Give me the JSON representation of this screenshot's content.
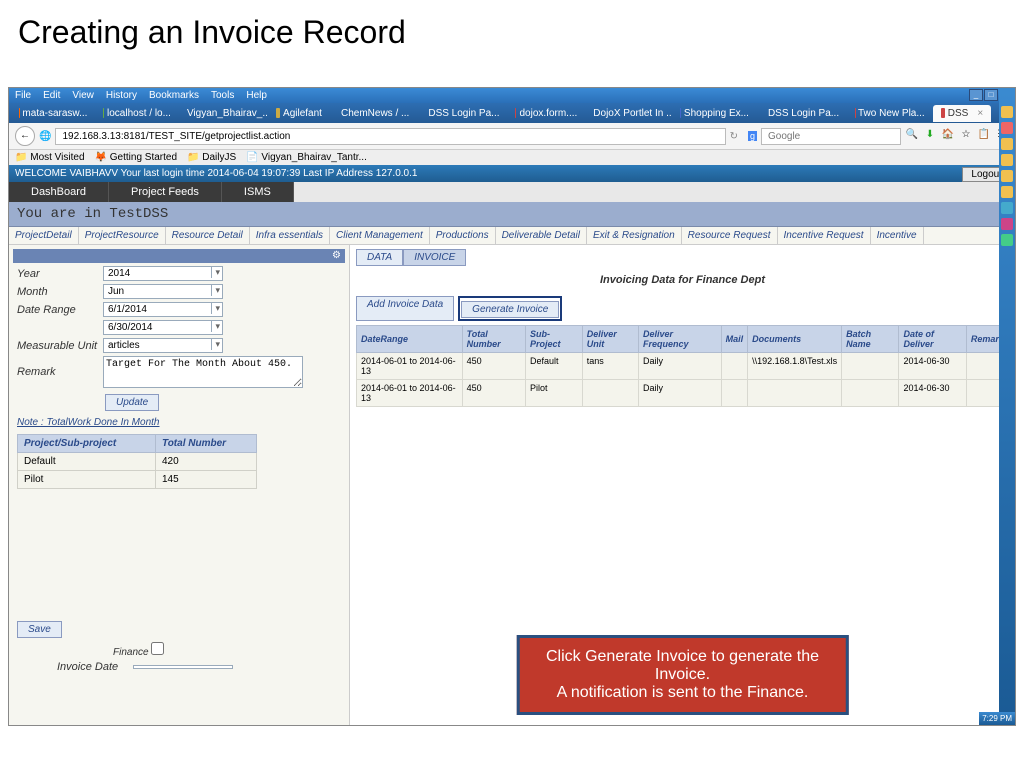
{
  "slide_title": "Creating an Invoice Record",
  "menu": [
    "File",
    "Edit",
    "View",
    "History",
    "Bookmarks",
    "Tools",
    "Help"
  ],
  "tabs": [
    "mata-sarasw...",
    "localhost / lo...",
    "Vigyan_Bhairav_...",
    "Agilefant",
    "ChemNews / ...",
    "DSS Login Pa...",
    "dojox.form....",
    "DojoX Portlet In ...",
    "Shopping Ex...",
    "DSS Login Pa...",
    "Two New Pla..."
  ],
  "active_tab": "DSS",
  "url": "192.168.3.13:8181/TEST_SITE/getprojectlist.action",
  "search_ph": "Google",
  "bookmarks": [
    "Most Visited",
    "Getting Started",
    "DailyJS",
    "Vigyan_Bhairav_Tantr..."
  ],
  "welcome": "WELCOME  VAIBHAVV  Your last login time 2014-06-04 19:07:39 Last IP Address 127.0.0.1",
  "logout": "Logout",
  "app_tabs": [
    "DashBoard",
    "Project Feeds",
    "ISMS"
  ],
  "you_are_in": "You are in TestDSS",
  "sub_tabs": [
    "ProjectDetail",
    "ProjectResource",
    "Resource Detail",
    "Infra essentials",
    "Client Management",
    "Productions",
    "Deliverable Detail",
    "Exit & Resignation",
    "Resource Request",
    "Incentive Request",
    "Incentive"
  ],
  "form": {
    "year_lbl": "Year",
    "year": "2014",
    "month_lbl": "Month",
    "month": "Jun",
    "range_lbl": "Date Range",
    "date1": "6/1/2014",
    "date2": "6/30/2014",
    "unit_lbl": "Measurable Unit",
    "unit": "articles",
    "remark_lbl": "Remark",
    "remark": "Target For The Month About 450.",
    "update": "Update"
  },
  "note": "Note : TotalWork Done In Month",
  "mini": {
    "h1": "Project/Sub-project",
    "h2": "Total Number",
    "rows": [
      {
        "p": "Default",
        "n": "420"
      },
      {
        "p": "Pilot",
        "n": "145"
      }
    ]
  },
  "save": "Save",
  "finance_lbl": "Finance",
  "inv_date_lbl": "Invoice Date",
  "di_tabs": {
    "data": "DATA",
    "invoice": "INVOICE"
  },
  "inv_title": "Invoicing Data for Finance Dept",
  "add_btn": "Add Invoice Data",
  "gen_btn": "Generate Invoice",
  "inv_headers": [
    "DateRange",
    "Total Number",
    "Sub-Project",
    "Deliver Unit",
    "Deliver Frequency",
    "Mail",
    "Documents",
    "Batch Name",
    "Date of Deliver",
    "Remark"
  ],
  "inv_rows": [
    {
      "dr": "2014-06-01 to 2014-06-13",
      "tn": "450",
      "sp": "Default",
      "du": "tans",
      "df": "Daily",
      "ml": "",
      "doc": "\\\\192.168.1.8\\Test.xls",
      "bn": "",
      "dd": "2014-06-30",
      "rm": ""
    },
    {
      "dr": "2014-06-01 to 2014-06-13",
      "tn": "450",
      "sp": "Pilot",
      "du": "",
      "df": "Daily",
      "ml": "",
      "doc": "",
      "bn": "",
      "dd": "2014-06-30",
      "rm": ""
    }
  ],
  "callout1": "Click Generate Invoice to generate the Invoice.",
  "callout2": "A notification is sent to the Finance.",
  "clock": "7:29 PM"
}
